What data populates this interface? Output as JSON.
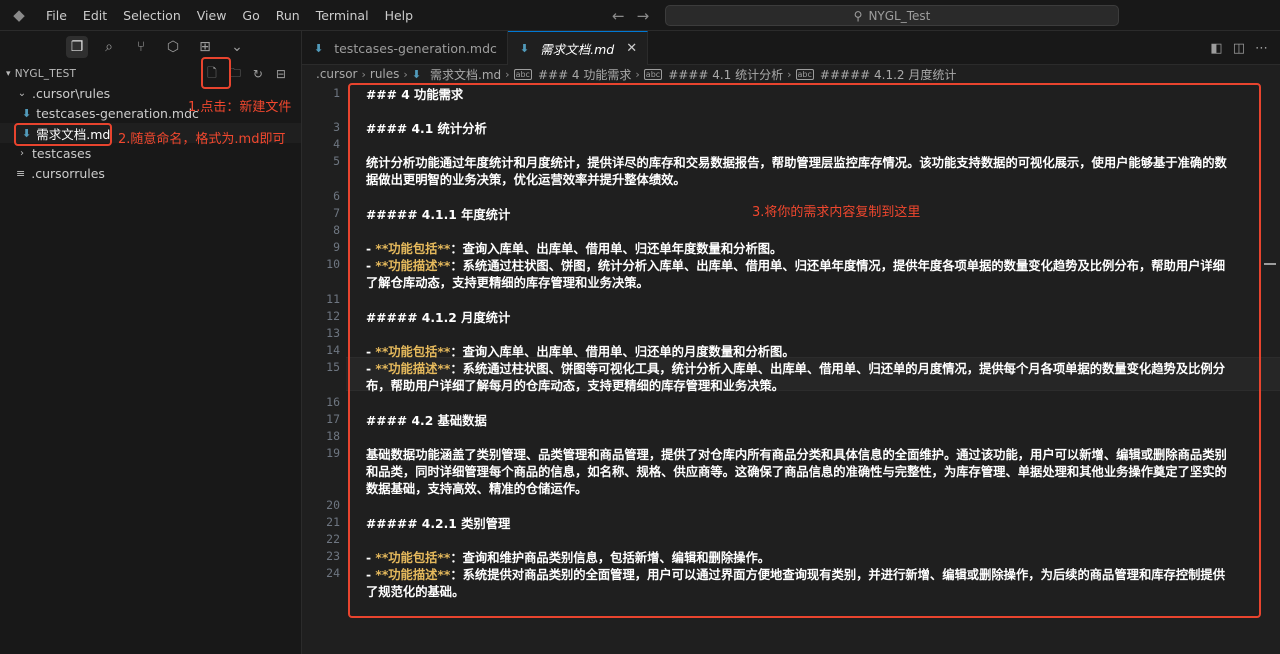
{
  "menubar": [
    "File",
    "Edit",
    "Selection",
    "View",
    "Go",
    "Run",
    "Terminal",
    "Help"
  ],
  "search": {
    "text": "NYGL_Test"
  },
  "explorer": {
    "root": "NYGL_TEST",
    "items": [
      {
        "label": ".cursor\\rules"
      },
      {
        "label": "testcases-generation.mdc"
      },
      {
        "label": "需求文档.md"
      },
      {
        "label": "testcases"
      },
      {
        "label": ".cursorrules"
      }
    ]
  },
  "annotations": {
    "step1": "1.点击：新建文件",
    "step2": "2.随意命名，格式为.md即可",
    "step3": "3.将你的需求内容复制到这里"
  },
  "tabs": [
    {
      "label": "testcases-generation.mdc"
    },
    {
      "label": "需求文档.md"
    }
  ],
  "breadcrumb": [
    ".cursor",
    "rules",
    "需求文档.md",
    "### 4 功能需求",
    "#### 4.1 统计分析",
    "##### 4.1.2 月度统计"
  ],
  "editor": {
    "lines": {
      "l1": "### 4 功能需求",
      "l3": "#### 4.1 统计分析",
      "l5a": "统计分析功能通过年度统计和月度统计，提供详尽的库存和交易数据报告，帮助管理层监控库存情况。该功能支持数据的可视化展示，使用户能够基于准确的数",
      "l5b": "据做出更明智的业务决策，优化运营效率并提升整体绩效。",
      "l7": "##### 4.1.1 年度统计",
      "l9kw": "**功能包括**",
      "l9": "：查询入库单、出库单、借用单、归还单年度数量和分析图。",
      "l10kw": "**功能描述**",
      "l10a": "：系统通过柱状图、饼图，统计分析入库单、出库单、借用单、归还单年度情况，提供年度各项单据的数量变化趋势及比例分布，帮助用户详细",
      "l10b": "了解仓库动态，支持更精细的库存管理和业务决策。",
      "l12": "##### 4.1.2 月度统计",
      "l14kw": "**功能包括**",
      "l14": "：查询入库单、出库单、借用单、归还单的月度数量和分析图。",
      "l15kw": "**功能描述**",
      "l15a": "：系统通过柱状图、饼图等可视化工具，统计分析入库单、出库单、借用单、归还单的月度情况，提供每个月各项单据的数量变化趋势及比例分",
      "l15b": "布，帮助用户详细了解每月的仓库动态，支持更精细的库存管理和业务决策。",
      "l17": "#### 4.2 基础数据",
      "l19a": "基础数据功能涵盖了类别管理、品类管理和商品管理，提供了对仓库内所有商品分类和具体信息的全面维护。通过该功能，用户可以新增、编辑或删除商品类别",
      "l19b": "和品类，同时详细管理每个商品的信息，如名称、规格、供应商等。这确保了商品信息的准确性与完整性，为库存管理、单据处理和其他业务操作奠定了坚实的",
      "l19c": "数据基础，支持高效、精准的仓储运作。",
      "l21": "##### 4.2.1 类别管理",
      "l23kw": "**功能包括**",
      "l23": "：查询和维护商品类别信息，包括新增、编辑和删除操作。",
      "l24kw": "**功能描述**",
      "l24a": "：系统提供对商品类别的全面管理，用户可以通过界面方便地查询现有类别，并进行新增、编辑或删除操作，为后续的商品管理和库存控制提供",
      "l24b": "了规范化的基础。"
    },
    "dash": "- "
  },
  "line_numbers": [
    "1",
    "3",
    "4",
    "5",
    "6",
    "7",
    "8",
    "9",
    "10",
    "11",
    "12",
    "13",
    "14",
    "15",
    "16",
    "17",
    "18",
    "19",
    "20",
    "21",
    "22",
    "23",
    "24"
  ],
  "colors": {
    "annotation": "#e8442e",
    "bold_keyword": "#e5b95c",
    "accent": "#0078d4"
  }
}
